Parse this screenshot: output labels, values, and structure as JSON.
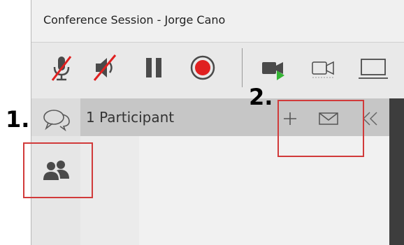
{
  "window": {
    "title": "Conference Session - Jorge Cano"
  },
  "toolbar": {
    "buttons": [
      {
        "name": "mute-microphone-button",
        "icon": "microphone-muted-icon"
      },
      {
        "name": "mute-speaker-button",
        "icon": "speaker-muted-icon"
      },
      {
        "name": "pause-button",
        "icon": "pause-icon"
      },
      {
        "name": "record-button",
        "icon": "record-icon"
      },
      {
        "name": "video-share-button",
        "icon": "video-camera-icon"
      },
      {
        "name": "camera-button",
        "icon": "camera-outline-icon"
      },
      {
        "name": "screen-share-button",
        "icon": "monitor-icon"
      }
    ]
  },
  "panel": {
    "participant_count": "1 Participant",
    "actions": [
      {
        "name": "add-participant-button",
        "icon": "plus-icon"
      },
      {
        "name": "invite-email-button",
        "icon": "envelope-icon"
      },
      {
        "name": "collapse-panel-button",
        "icon": "double-chevron-left-icon"
      }
    ]
  },
  "sidebar": {
    "items": [
      {
        "name": "chat-tab",
        "icon": "chat-bubbles-icon"
      },
      {
        "name": "participants-tab",
        "icon": "people-icon"
      }
    ]
  },
  "annotations": [
    {
      "label": "1.",
      "color": "#d13a3a"
    },
    {
      "label": "2.",
      "color": "#d13a3a"
    }
  ],
  "colors": {
    "accent_red": "#e02020",
    "video_green": "#35b535",
    "annotation": "#d13a3a"
  }
}
